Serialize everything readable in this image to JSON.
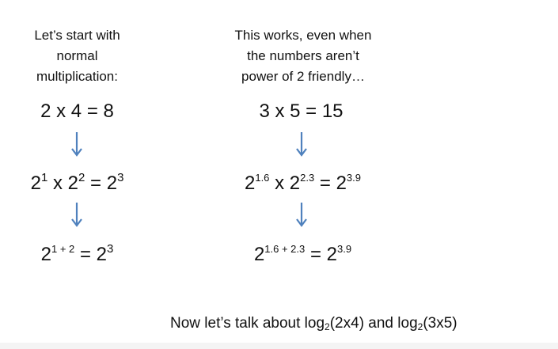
{
  "left_column": {
    "intro_lines": [
      "Let’s start with",
      "normal",
      "multiplication:"
    ],
    "eq1": "2 x 4 = 8",
    "eq2": {
      "b1": "2",
      "e1": "1",
      "b2": "2",
      "e2": "2",
      "b3": "2",
      "e3": "3"
    },
    "eq3": {
      "b1": "2",
      "e1": "1 + 2",
      "b2": "2",
      "e2": "3"
    }
  },
  "right_column": {
    "intro_lines": [
      "This works, even when",
      "the numbers aren’t",
      "power of 2 friendly…"
    ],
    "eq1": "3 x 5 = 15",
    "eq2": {
      "b1": "2",
      "e1": "1.6",
      "b2": "2",
      "e2": "2.3",
      "b3": "2",
      "e3": "3.9"
    },
    "eq3": {
      "b1": "2",
      "e1": "1.6 + 2.3",
      "b2": "2",
      "e2": "3.9"
    }
  },
  "footer": {
    "prefix": "Now let’s talk about log",
    "sub1": "2",
    "mid": "(2x4) and log",
    "sub2": "2",
    "suffix": "(3x5)"
  },
  "arrow_color": "#4f81bd"
}
